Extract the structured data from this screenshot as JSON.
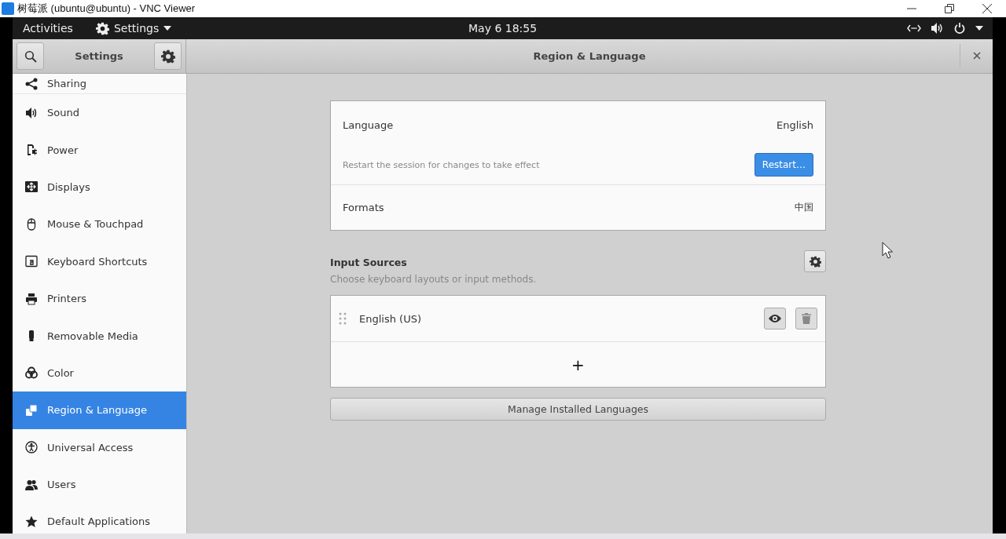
{
  "vnc_window": {
    "title": "树莓派 (ubuntu@ubuntu) - VNC Viewer"
  },
  "top_bar": {
    "activities": "Activities",
    "app_menu": "Settings",
    "clock": "May 6  18:55"
  },
  "header": {
    "sidebar_title": "Settings",
    "panel_title": "Region & Language"
  },
  "sidebar": {
    "items": [
      {
        "label": "Sharing",
        "selected": false
      },
      {
        "label": "Sound",
        "selected": false
      },
      {
        "label": "Power",
        "selected": false
      },
      {
        "label": "Displays",
        "selected": false
      },
      {
        "label": "Mouse & Touchpad",
        "selected": false
      },
      {
        "label": "Keyboard Shortcuts",
        "selected": false
      },
      {
        "label": "Printers",
        "selected": false
      },
      {
        "label": "Removable Media",
        "selected": false
      },
      {
        "label": "Color",
        "selected": false
      },
      {
        "label": "Region & Language",
        "selected": true
      },
      {
        "label": "Universal Access",
        "selected": false
      },
      {
        "label": "Users",
        "selected": false
      },
      {
        "label": "Default Applications",
        "selected": false
      }
    ]
  },
  "language_card": {
    "language_label": "Language",
    "language_value": "English",
    "restart_note": "Restart the session for changes to take effect",
    "restart_button": "Restart…",
    "formats_label": "Formats",
    "formats_value": "中国"
  },
  "input_sources": {
    "title": "Input Sources",
    "description": "Choose keyboard layouts or input methods.",
    "sources": [
      {
        "name": "English (US)"
      }
    ],
    "add_button": "+"
  },
  "manage_button": "Manage Installed Languages"
}
